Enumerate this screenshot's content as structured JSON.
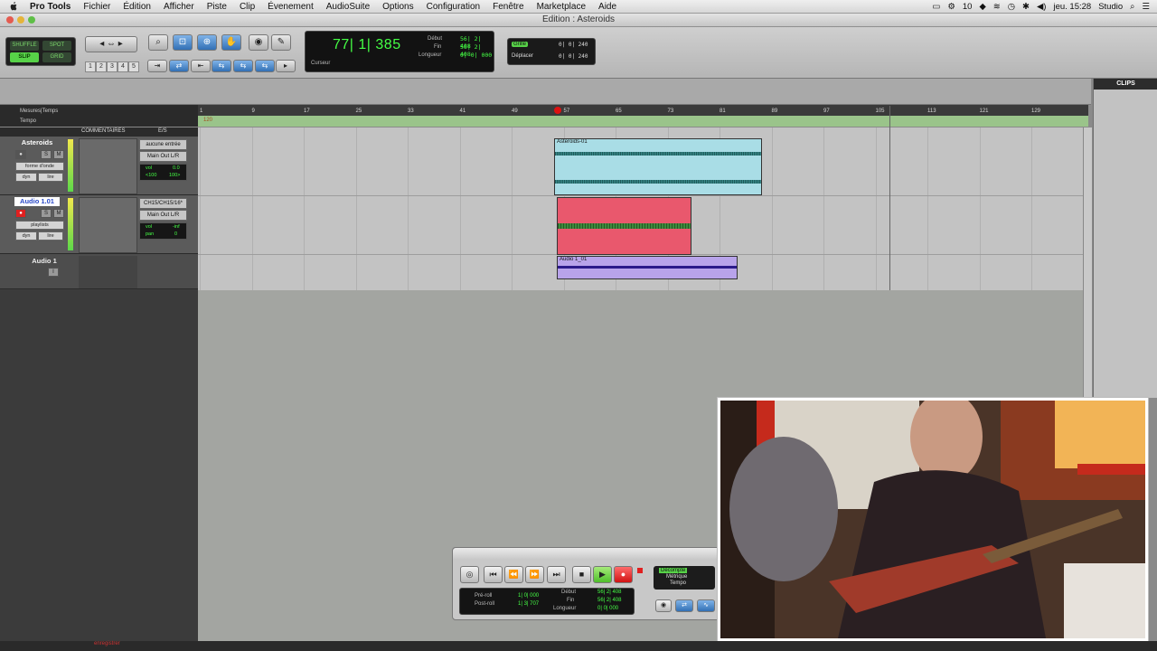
{
  "menubar": {
    "app": "Pro Tools",
    "items": [
      "Fichier",
      "Édition",
      "Afficher",
      "Piste",
      "Clip",
      "Évenement",
      "AudioSuite",
      "Options",
      "Configuration",
      "Fenêtre",
      "Marketplace",
      "Aide"
    ],
    "status_num": "10",
    "clock": "jeu. 15:28",
    "user": "Studio"
  },
  "window": {
    "title": "Edition : Asteroids"
  },
  "toolbar": {
    "modes": [
      "SHUFFLE",
      "SPOT",
      "SLIP",
      "GRID"
    ],
    "zoom_presets": [
      "1",
      "2",
      "3",
      "4",
      "5"
    ],
    "counter": {
      "main": "77| 1| 385",
      "cursor_label": "Curseur",
      "start_label": "Début",
      "end_label": "Fin",
      "length_label": "Longueur",
      "start_val": "56| 2| 408",
      "end_val": "56| 2| 408",
      "length_val": "0| 0| 000"
    },
    "grid": {
      "grid_label": "Grille",
      "nudge_label": "Déplacer",
      "grid_val": "0| 0| 240",
      "nudge_val": "0| 0| 240"
    }
  },
  "ruler": {
    "labels": [
      "Mesures|Temps",
      "Tempo"
    ],
    "bars": [
      "1",
      "9",
      "17",
      "25",
      "33",
      "41",
      "49",
      "57",
      "65",
      "73",
      "81",
      "89",
      "97",
      "105",
      "113",
      "121",
      "129"
    ],
    "tempo_val": "120"
  },
  "columns": {
    "comments": "COMMENTAIRES",
    "io": "E/S"
  },
  "tracks": [
    {
      "name": "Asteroids",
      "buttons": [
        "S",
        "M"
      ],
      "view": "forme d'onde",
      "dyn": "dyn",
      "read": "lire",
      "input": "aucune entrée",
      "output": "Main Out L/R",
      "vol": "vol",
      "vol_val": "0.0",
      "pan": "<100",
      "pan2": "100>"
    },
    {
      "name": "Audio 1.01",
      "buttons": [
        "S",
        "M"
      ],
      "view": "playlists",
      "dyn": "dyn",
      "read": "lire",
      "input": "CH15/CH15/16*",
      "output": "Main Out L/R",
      "vol": "vol",
      "vol_val": "-inf",
      "pan": "pan",
      "pan_val": "0"
    },
    {
      "name": "Audio 1"
    }
  ],
  "clips": [
    {
      "name": "Asteroids-01",
      "color": "#a9dde6"
    },
    {
      "name": "",
      "color": "#e9586d"
    },
    {
      "name": "Audio 1_01",
      "color": "#b8a3ea"
    }
  ],
  "cliplist": {
    "title": "CLIPS"
  },
  "transport": {
    "preroll": "Pré-roll",
    "postroll": "Post-roll",
    "preroll_val": "1| 0| 000",
    "postroll_val": "1| 3| 707",
    "start_label": "Début",
    "end_label": "Fin",
    "length_label": "Longueur",
    "start_val": "56| 2| 408",
    "end_val": "56| 2| 408",
    "length_val": "0| 0| 000",
    "countoff": "Décompte",
    "meter": "Métrique",
    "tempo": "Tempo"
  },
  "bottom_bar": {
    "label": "enregistrer"
  },
  "colors": {
    "counter_green": "#45ff45",
    "ruler_green": "#9ac48a",
    "record_red": "#e02020"
  }
}
